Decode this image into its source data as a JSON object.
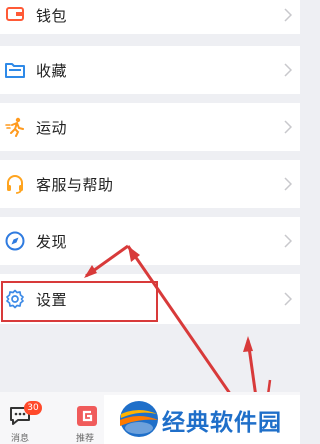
{
  "menu": {
    "wallet": "钱包",
    "favorites": "收藏",
    "sport": "运动",
    "service": "客服与帮助",
    "discover": "发现",
    "settings": "设置"
  },
  "tabbar": {
    "messages_label": "消息",
    "messages_badge": "30",
    "recommend_label": "推荐"
  },
  "watermark": {
    "text": "经典软件园"
  },
  "colors": {
    "accent_blue": "#1f8ef1",
    "wallet_red": "#ff5a36",
    "fav_blue": "#2f8ae8",
    "sport_orange": "#ff9a1e",
    "service_orange": "#ffa41f",
    "discover_blue": "#2f7be0",
    "settings_blue": "#3d8ae6",
    "annotation_red": "#d83a3a",
    "background": "#eeeff3"
  },
  "icons": {
    "wallet": "wallet-icon",
    "favorites": "folder-star-icon",
    "sport": "running-icon",
    "service": "headset-icon",
    "discover": "compass-icon",
    "settings": "gear-icon"
  }
}
